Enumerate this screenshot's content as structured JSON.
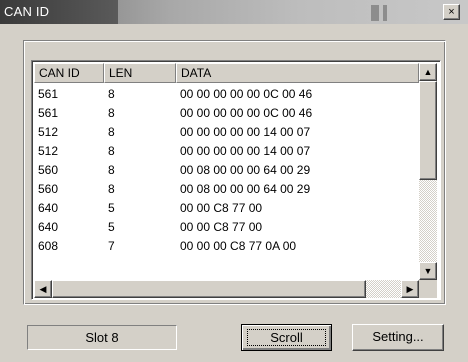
{
  "window": {
    "title": "CAN ID",
    "close_glyph": "×"
  },
  "table": {
    "columns": [
      "CAN ID",
      "LEN",
      "DATA"
    ],
    "rows": [
      {
        "id": "561",
        "len": "8",
        "data": "00 00 00 00 00 0C 00 46"
      },
      {
        "id": "561",
        "len": "8",
        "data": "00 00 00 00 00 0C 00 46"
      },
      {
        "id": "512",
        "len": "8",
        "data": "00 00 00 00 00 14 00 07"
      },
      {
        "id": "512",
        "len": "8",
        "data": "00 00 00 00 00 14 00 07"
      },
      {
        "id": "560",
        "len": "8",
        "data": "00 08 00 00 00 64 00 29"
      },
      {
        "id": "560",
        "len": "8",
        "data": "00 08 00 00 00 64 00 29"
      },
      {
        "id": "640",
        "len": "5",
        "data": "00 00 C8 77 00"
      },
      {
        "id": "640",
        "len": "5",
        "data": "00 00 C8 77 00"
      },
      {
        "id": "608",
        "len": "7",
        "data": "00 00 00 C8 77 0A 00"
      }
    ]
  },
  "icons": {
    "scroll_up": "arrow-up-icon",
    "scroll_down": "arrow-down-icon",
    "scroll_left": "arrow-left-icon",
    "scroll_right": "arrow-right-icon"
  },
  "footer": {
    "slot_label": "Slot 8",
    "scroll_button": "Scroll",
    "settings_button": "Setting..."
  },
  "colors": {
    "face": "#d4d0c8",
    "titlebar_dark": "#3a3a3a"
  }
}
